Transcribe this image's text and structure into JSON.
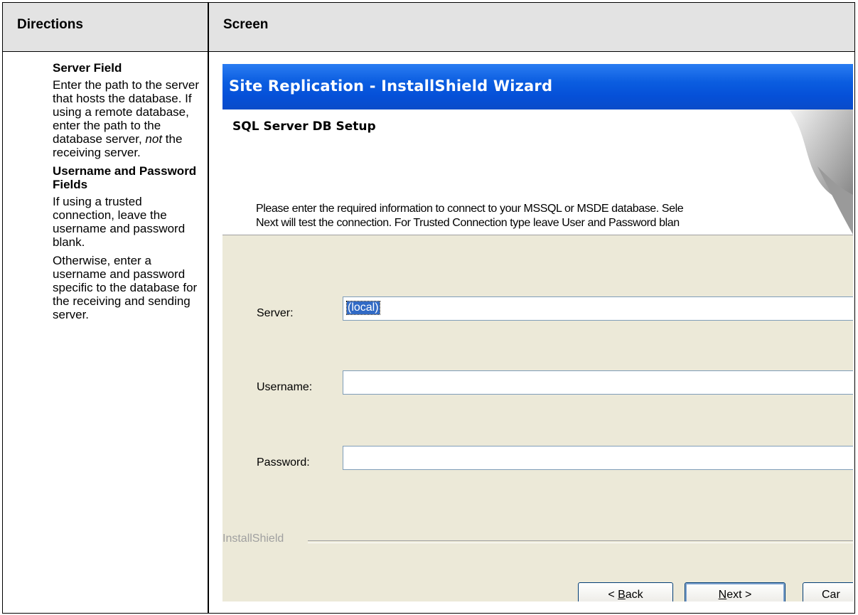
{
  "table": {
    "col_directions": "Directions",
    "col_screen": "Screen"
  },
  "directions": {
    "server_heading": "Server Field",
    "server_text_a": "Enter the path to the server that hosts the database. If using a remote database, enter the path to the database server, ",
    "server_text_em": "not",
    "server_text_b": " the receiving server.",
    "userpass_heading": "Username and Password Fields",
    "userpass_text_1": "If using a trusted connection, leave the username and password blank.",
    "userpass_text_2": "Otherwise, enter a username and password specific to the database for the receiving and sending server."
  },
  "wizard": {
    "title": "Site Replication - InstallShield Wizard",
    "banner_title": "SQL Server DB Setup",
    "intro_line1": "Please enter the required information to connect to your MSSQL or MSDE database. Sele",
    "intro_line2": "Next will test the connection. For Trusted Connection type leave User and Password blan",
    "server_label": "Server:",
    "server_value": "(local)",
    "username_label": "Username:",
    "username_value": "",
    "password_label": "Password:",
    "password_value": "",
    "brand": "InstallShield",
    "back_pre": "< ",
    "back_key": "B",
    "back_post": "ack",
    "next_key": "N",
    "next_post": "ext >",
    "cancel": "Car"
  }
}
